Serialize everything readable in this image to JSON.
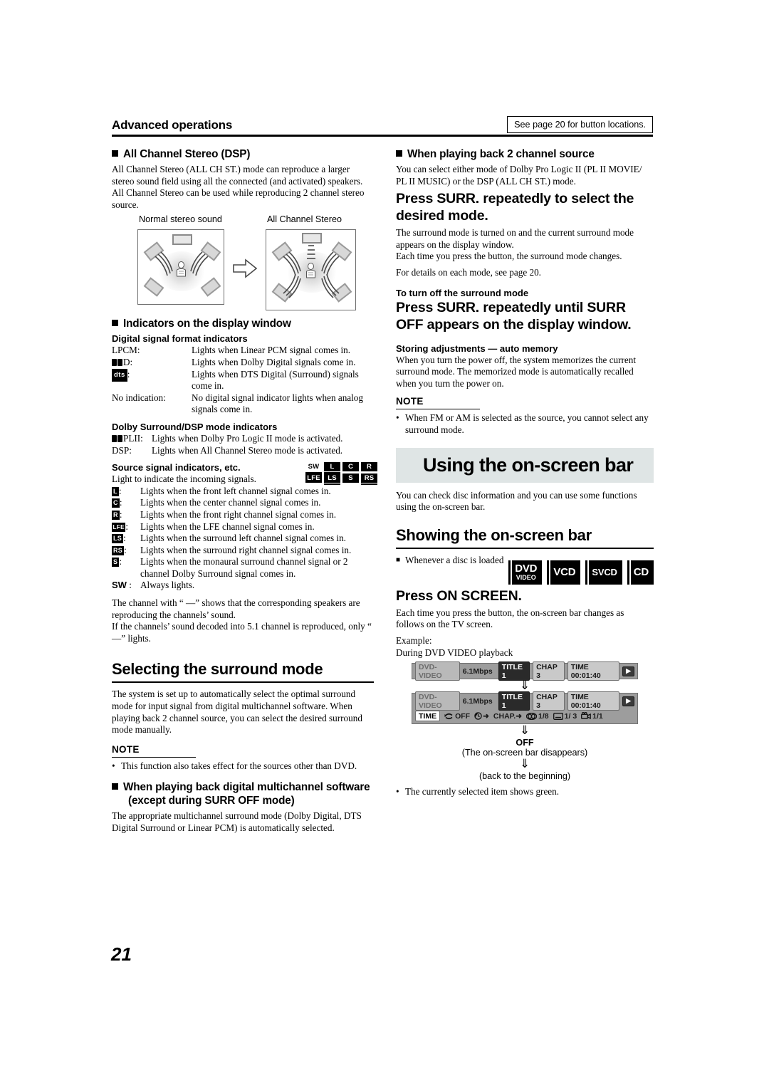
{
  "header": {
    "section_title": "Advanced operations",
    "see_page_note": "See page 20 for button locations."
  },
  "page_number": "21",
  "left_column": {
    "all_channel_stereo": {
      "heading": "All Channel Stereo (DSP)",
      "body": "All Channel Stereo (ALL CH ST.) mode can reproduce a larger stereo sound field using all the connected (and activated) speakers. All Channel Stereo can be used while reproducing 2 channel stereo source.",
      "diagram": {
        "left_label": "Normal stereo sound",
        "right_label": "All Channel Stereo"
      }
    },
    "indicators": {
      "heading": "Indicators on the display window",
      "digital_format": {
        "subheading": "Digital signal format indicators",
        "rows": [
          {
            "term": "LPCM:",
            "desc": "Lights when Linear PCM signal comes in."
          },
          {
            "term": "D:",
            "term_icon": "dolby-double-d-icon",
            "desc": "Lights when Dolby Digital signals come in."
          },
          {
            "term": ":",
            "term_icon": "dts-logo-icon",
            "desc": "Lights when DTS Digital (Surround) signals come in."
          },
          {
            "term": "No indication:",
            "desc": "No digital signal indicator lights when analog signals come in."
          }
        ]
      },
      "dolby_dsp": {
        "subheading": "Dolby Surround/DSP mode indicators",
        "rows": [
          {
            "term": "PLII:",
            "term_icon": "dolby-double-d-icon",
            "desc": "Lights when Dolby Pro Logic II mode is activated."
          },
          {
            "term": "DSP:",
            "desc": "Lights when All Channel Stereo mode is activated."
          }
        ]
      },
      "source_signal": {
        "subheading": "Source signal indicators, etc.",
        "intro": "Light to indicate the incoming signals.",
        "cluster": {
          "row1": [
            {
              "label": "SW",
              "style": "plain",
              "underline": true
            },
            {
              "label": "L",
              "style": "inv",
              "underline": true
            },
            {
              "label": "C",
              "style": "inv",
              "underline": false
            },
            {
              "label": "R",
              "style": "inv",
              "underline": false
            }
          ],
          "row2": [
            {
              "label": "LFE",
              "style": "inv",
              "underline": false
            },
            {
              "label": "LS",
              "style": "inv",
              "underline": true
            },
            {
              "label": "S",
              "style": "inv",
              "underline": false
            },
            {
              "label": "RS",
              "style": "inv",
              "underline": true
            }
          ]
        },
        "rows": [
          {
            "badge": "L",
            "desc": "Lights when the front left channel signal comes in."
          },
          {
            "badge": "C",
            "desc": "Lights when the center channel signal comes in."
          },
          {
            "badge": "R",
            "desc": "Lights when the front right channel signal comes in."
          },
          {
            "badge": "LFE",
            "desc": "Lights when the LFE channel signal comes in."
          },
          {
            "badge": "LS",
            "desc": "Lights when the surround left channel signal comes in."
          },
          {
            "badge": "RS",
            "desc": "Lights when the surround right channel signal comes in."
          },
          {
            "badge": "S",
            "desc": "Lights when the monaural surround channel signal or 2 channel Dolby Surround signal comes in."
          },
          {
            "badge": "SW",
            "plain": true,
            "desc": "Always lights."
          }
        ],
        "footnotes": [
          "The channel with “ —” shows that the corresponding speakers are reproducing the channels’ sound.",
          "If the channels’ sound decoded into 5.1 channel is reproduced, only “ —” lights."
        ]
      }
    },
    "selecting_surround": {
      "heading": "Selecting the surround mode",
      "body": "The system is set up to automatically select the optimal surround mode for input signal from digital multichannel software. When playing back 2 channel source, you can select the desired surround mode manually.",
      "note_label": "NOTE",
      "note_items": [
        "This function also takes effect for the sources other than DVD."
      ],
      "sub_heading_line1": "When playing back digital multichannel software",
      "sub_heading_line2": "(except during SURR OFF mode)",
      "sub_body": "The appropriate multichannel surround mode (Dolby Digital, DTS Digital Surround or Linear PCM) is automatically selected."
    }
  },
  "right_column": {
    "two_channel": {
      "heading": "When playing back 2 channel source",
      "body": "You can select either mode of Dolby Pro Logic II (PL II MOVIE/ PL II MUSIC) or the DSP (ALL CH ST.) mode.",
      "press_head": "Press SURR. repeatedly to select the desired mode.",
      "body2_line1": "The surround mode is turned on and the current surround mode appears on the display window.",
      "body2_line2": "Each time you press the button, the surround mode changes.",
      "body2_line3": "For details on each mode, see page 20.",
      "turn_off_label": "To turn off the surround mode",
      "turn_off_head": "Press SURR. repeatedly until SURR OFF appears on the display window.",
      "storing_label": "Storing adjustments — auto memory",
      "storing_body": "When you turn the power off, the system memorizes the current surround mode. The memorized mode is automatically recalled when you turn the power on.",
      "note_label": "NOTE",
      "note_items": [
        "When FM or AM is selected as the source, you cannot select any surround mode."
      ]
    },
    "using_bar": {
      "banner_title": "Using the on-screen bar",
      "body": "You can check disc information and you can use some functions using the on-screen bar."
    },
    "showing_bar": {
      "heading": "Showing the on-screen bar",
      "bullet": "Whenever a disc is loaded",
      "disc_badges": [
        {
          "line1": "DVD",
          "line2": "VIDEO"
        },
        {
          "line1": "VCD",
          "line2": ""
        },
        {
          "line1": "SVCD",
          "line2": ""
        },
        {
          "line1": "CD",
          "line2": ""
        }
      ],
      "press_head": "Press ON SCREEN.",
      "body1": "Each time you press the button, the on-screen bar changes as follows on the TV screen.",
      "example_label": "Example:",
      "example_sub": "During DVD VIDEO playback",
      "osbar1": {
        "disc_type": "DVD-VIDEO",
        "bitrate": "6.1Mbps",
        "title": "TITLE  1",
        "chapter": "CHAP  3",
        "time": "TIME 00:01:40",
        "play_icon": "play-triangle-icon"
      },
      "osbar2": {
        "disc_type": "DVD-VIDEO",
        "bitrate": "6.1Mbps",
        "title": "TITLE  1",
        "chapter": "CHAP  3",
        "time": "TIME 00:01:40",
        "play_icon": "play-triangle-icon",
        "row2": [
          {
            "icon": "",
            "label": "TIME",
            "style": "white"
          },
          {
            "icon": "repeat-icon",
            "label": "OFF",
            "style": "plain"
          },
          {
            "icon": "clock-icon",
            "label": "➜",
            "style": "plain"
          },
          {
            "icon": "",
            "label": "CHAP.➜",
            "style": "plain"
          },
          {
            "icon": "audio-icon",
            "label": "1/8",
            "style": "plain"
          },
          {
            "icon": "subtitle-icon",
            "label": "1/ 3",
            "style": "plain"
          },
          {
            "icon": "angle-icon",
            "label": "1/1",
            "style": "plain"
          }
        ]
      },
      "flow": {
        "arrow": "⇩",
        "off_label": "OFF",
        "off_sub": "(The on-screen bar disappears)",
        "back_label": "(back to the beginning)"
      },
      "footnote": "The currently selected item shows green."
    }
  }
}
